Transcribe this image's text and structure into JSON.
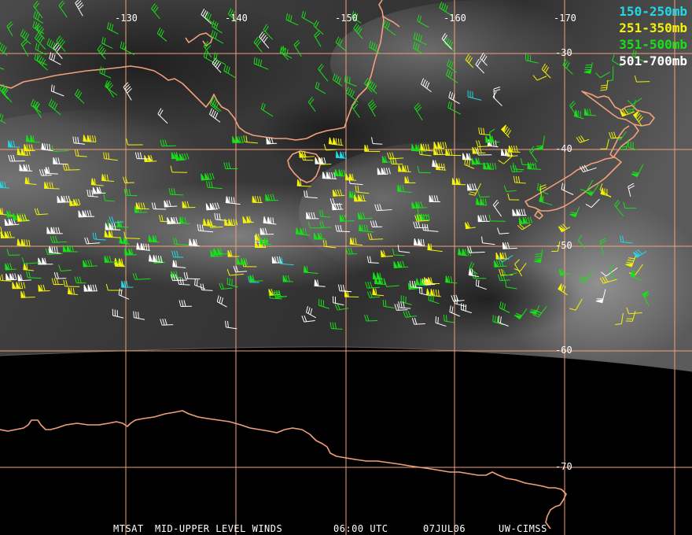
{
  "product": {
    "satellite": "MTSAT",
    "product_name": "MID-UPPER LEVEL WINDS",
    "time": "06:00 UTC",
    "date": "07JUL06",
    "source": "UW-CIMSS"
  },
  "legend": [
    {
      "label": "150-250mb",
      "color": "#22d8e8"
    },
    {
      "label": "251-350mb",
      "color": "#f2f20a"
    },
    {
      "label": "351-500mb",
      "color": "#18e018"
    },
    {
      "label": "501-700mb",
      "color": "#ffffff"
    }
  ],
  "graticule": {
    "color": "#f0a07a",
    "longitudes": [
      "-130",
      "-140",
      "-150",
      "-160",
      "-170"
    ],
    "latitudes": [
      "-30",
      "-40",
      "-50",
      "-60",
      "-70"
    ]
  },
  "colors": {
    "coastline": "#f2a07c",
    "space": "#000000"
  }
}
